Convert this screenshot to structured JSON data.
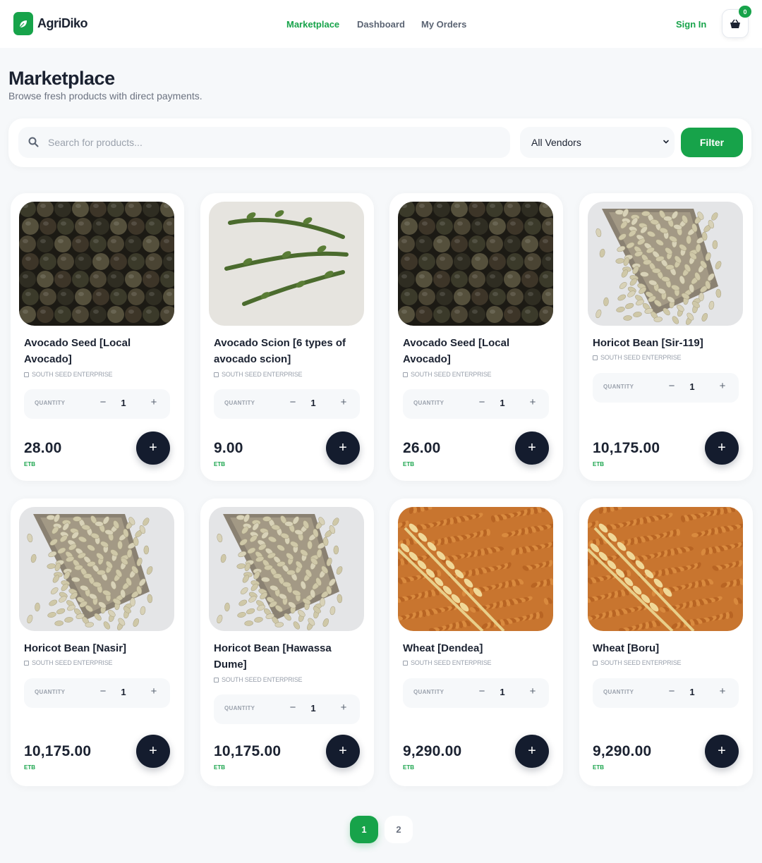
{
  "header": {
    "logo_text": "AgriDiko",
    "nav": [
      "Marketplace",
      "Dashboard",
      "My Orders"
    ],
    "sign_in": "Sign In",
    "cart_count": "0"
  },
  "page": {
    "title": "Marketplace",
    "subtitle": "Browse fresh products with direct payments."
  },
  "search": {
    "placeholder": "Search for products...",
    "vendor_filter": "All Vendors",
    "filter_label": "Filter"
  },
  "qty_label": "QUANTITY",
  "products": [
    {
      "name": "Avocado Seed [Local Avocado]",
      "vendor": "SOUTH SEED ENTERPRISE",
      "quantity": "1",
      "price": "28.00",
      "currency": "ETB",
      "image": "avocado-image"
    },
    {
      "name": "Avocado Scion [6 types of avocado scion]",
      "vendor": "SOUTH SEED ENTERPRISE",
      "quantity": "1",
      "price": "9.00",
      "currency": "ETB",
      "image": "scion-image"
    },
    {
      "name": "Avocado Seed [Local Avocado]",
      "vendor": "SOUTH SEED ENTERPRISE",
      "quantity": "1",
      "price": "26.00",
      "currency": "ETB",
      "image": "avocado-image"
    },
    {
      "name": "Horicot Bean [Sir-119]",
      "vendor": "SOUTH SEED ENTERPRISE",
      "quantity": "1",
      "price": "10,175.00",
      "currency": "ETB",
      "image": "bean-image"
    },
    {
      "name": "Horicot Bean [Nasir]",
      "vendor": "SOUTH SEED ENTERPRISE",
      "quantity": "1",
      "price": "10,175.00",
      "currency": "ETB",
      "image": "bean-image"
    },
    {
      "name": "Horicot Bean [Hawassa Dume]",
      "vendor": "SOUTH SEED ENTERPRISE",
      "quantity": "1",
      "price": "10,175.00",
      "currency": "ETB",
      "image": "bean-image"
    },
    {
      "name": "Wheat [Dendea]",
      "vendor": "SOUTH SEED ENTERPRISE",
      "quantity": "1",
      "price": "9,290.00",
      "currency": "ETB",
      "image": "wheat-image"
    },
    {
      "name": "Wheat [Boru]",
      "vendor": "SOUTH SEED ENTERPRISE",
      "quantity": "1",
      "price": "9,290.00",
      "currency": "ETB",
      "image": "wheat-image"
    }
  ],
  "pagination": [
    "1",
    "2"
  ],
  "colors": {
    "accent": "#17a34a",
    "dark": "#141c2e",
    "background": "#f6f8fa"
  }
}
